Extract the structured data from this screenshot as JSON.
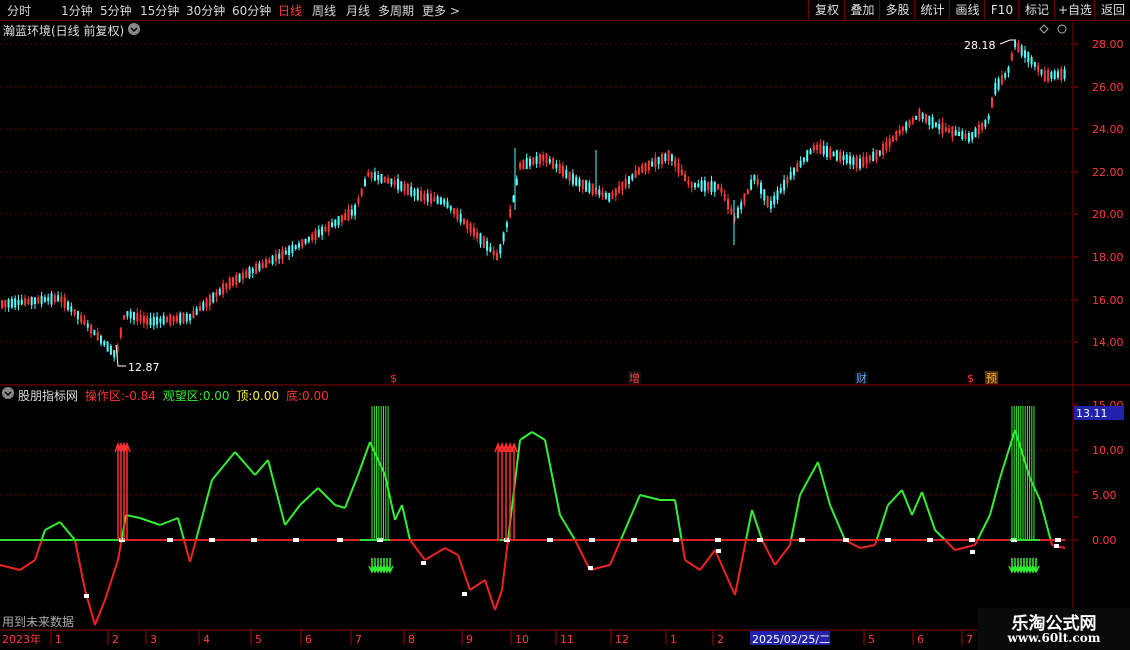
{
  "toolbar": {
    "timeframes": [
      "分时",
      "1分钟",
      "5分钟",
      "15分钟",
      "30分钟",
      "60分钟",
      "日线",
      "周线",
      "月线",
      "多周期",
      "更多"
    ],
    "active_timeframe": "日线",
    "buttons": [
      "复权",
      "叠加",
      "多股",
      "统计",
      "画线",
      "F10",
      "标记",
      "+自选",
      "返回"
    ]
  },
  "price_panel": {
    "title": "瀚蓝环境(日线 前复权)",
    "high_label": "28.18",
    "low_label": "12.87",
    "y_ticks": [
      "28.00",
      "26.00",
      "24.00",
      "22.00",
      "20.00",
      "18.00",
      "16.00",
      "14.00"
    ],
    "markers": [
      "$",
      "增",
      "财",
      "$",
      "预"
    ]
  },
  "indicator_panel": {
    "name": "股朋指标网",
    "op_label": "操作区:",
    "op_value": "-0.84",
    "watch_label": "观望区:",
    "watch_value": "0.00",
    "top_label": "顶:",
    "top_value": "0.00",
    "bottom_label": "底:",
    "bottom_value": "0.00",
    "current_value": "13.11",
    "y_ticks": [
      "15.00",
      "10.00",
      "5.00",
      "0.00"
    ],
    "note": "用到未来数据"
  },
  "x_axis": {
    "labels": [
      "2023年",
      "1",
      "2",
      "3",
      "4",
      "5",
      "6",
      "7",
      "8",
      "9",
      "10",
      "11",
      "12",
      "1",
      "2",
      "2025/02/25/二",
      "5",
      "6",
      "7"
    ],
    "cursor_date": "2025/02/25/二"
  },
  "watermark": {
    "title": "乐淘公式网",
    "url": "www.60lt.com"
  },
  "colors": {
    "up": "#ff3a3a",
    "down": "#54ffff",
    "indicator_up": "#33ee33",
    "indicator_down": "#ee2222",
    "grid": "#6a0000",
    "cursor_bg": "#2222aa"
  }
}
